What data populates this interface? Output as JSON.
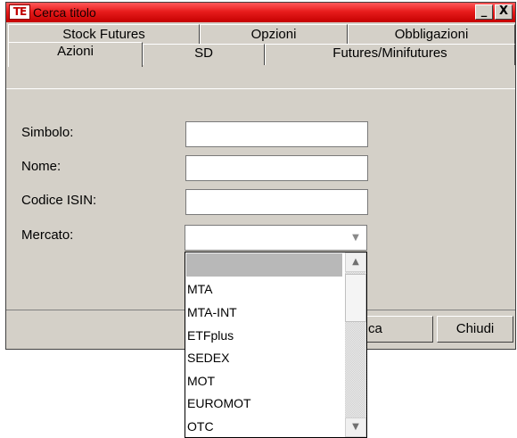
{
  "window": {
    "title": "Cerca titolo",
    "logo": "TE",
    "minimize_glyph": "_",
    "close_glyph": "X"
  },
  "tabs": {
    "back_row": [
      {
        "label": "Stock Futures"
      },
      {
        "label": "Opzioni"
      },
      {
        "label": "Obbligazioni"
      }
    ],
    "front_row": [
      {
        "label": "Azioni"
      },
      {
        "label": "SD"
      },
      {
        "label": "Futures/Minifutures"
      }
    ],
    "active": "Azioni"
  },
  "form": {
    "simbolo_label": "Simbolo:",
    "simbolo_value": "",
    "nome_label": "Nome:",
    "nome_value": "",
    "isin_label": "Codice ISIN:",
    "isin_value": "",
    "mercato_label": "Mercato:",
    "mercato_value": ""
  },
  "mercato_options": [
    "",
    "MTA",
    "MTA-INT",
    "ETFplus",
    "SEDEX",
    "MOT",
    "EUROMOT",
    "OTC"
  ],
  "buttons": {
    "search_label_visible": "ca",
    "close_label": "Chiudi"
  },
  "icons": {
    "combo_arrow": "chevron-down-icon",
    "scroll_up": "scroll-up-icon",
    "scroll_down": "scroll-down-icon"
  }
}
